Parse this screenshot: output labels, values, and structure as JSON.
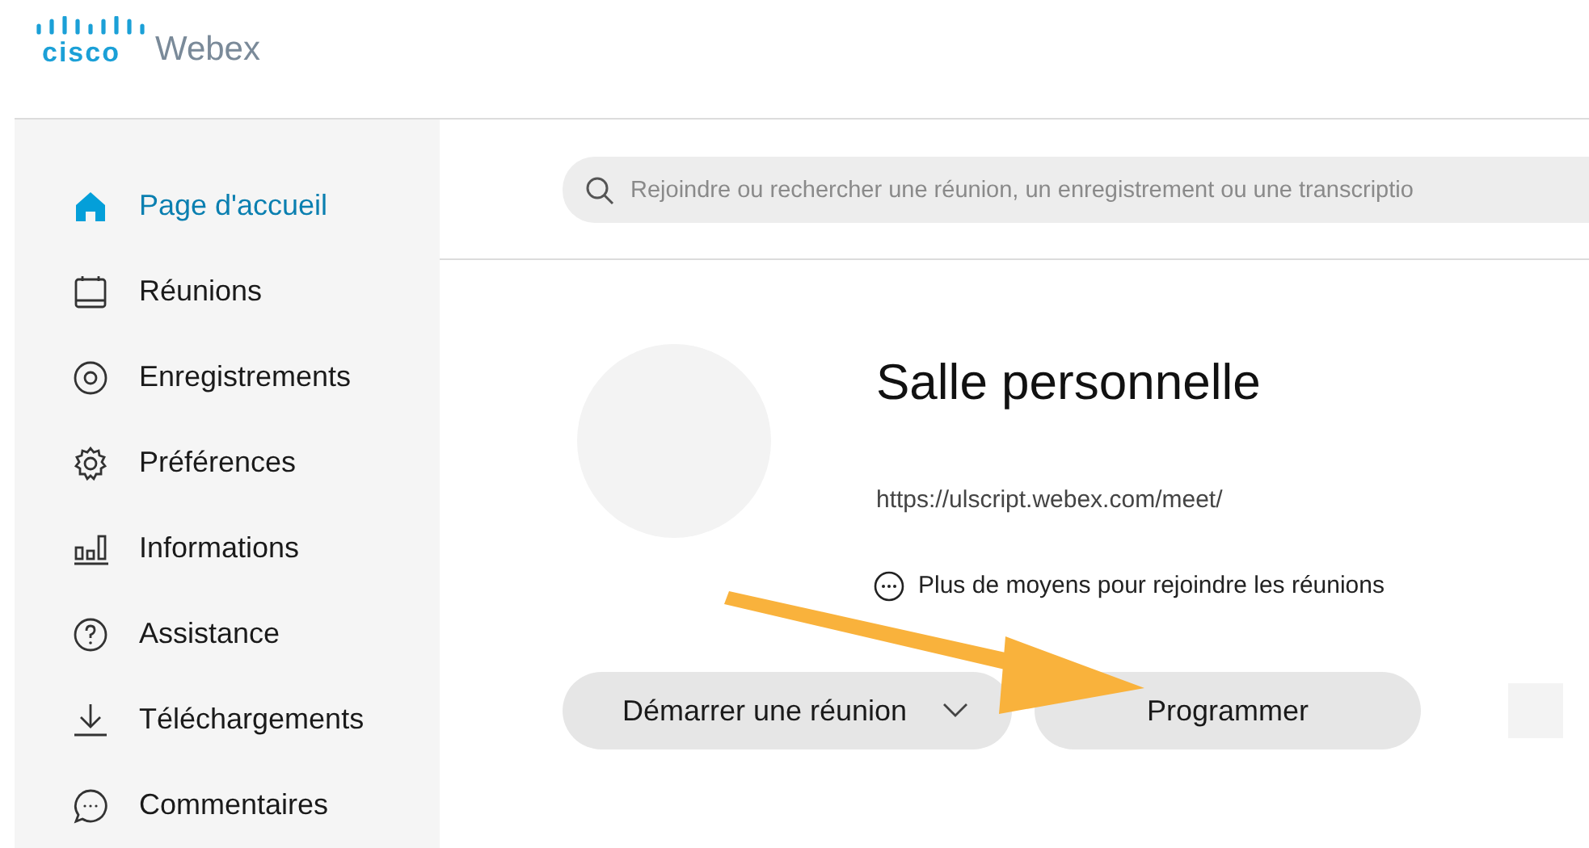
{
  "logo": {
    "brand": "cisco",
    "product": "Webex"
  },
  "sidebar": {
    "items": [
      {
        "kind": "home",
        "label": "Page d'accueil",
        "selected": true
      },
      {
        "kind": "calendar",
        "label": "Réunions",
        "selected": false
      },
      {
        "kind": "record",
        "label": "Enregistrements",
        "selected": false
      },
      {
        "kind": "gear",
        "label": "Préférences",
        "selected": false
      },
      {
        "kind": "bars",
        "label": "Informations",
        "selected": false
      },
      {
        "kind": "help",
        "label": "Assistance",
        "selected": false
      },
      {
        "kind": "download",
        "label": "Téléchargements",
        "selected": false
      },
      {
        "kind": "chat",
        "label": "Commentaires",
        "selected": false
      }
    ]
  },
  "search": {
    "placeholder": "Rejoindre ou rechercher une réunion, un enregistrement ou une transcriptio"
  },
  "room": {
    "title": "Salle personnelle",
    "url": "https://ulscript.webex.com/meet/",
    "more_ways": "Plus de moyens pour rejoindre les réunions"
  },
  "buttons": [
    {
      "kind": "dropdown",
      "label": "Démarrer une réunion"
    },
    {
      "kind": "plain",
      "label": "Programmer"
    }
  ]
}
